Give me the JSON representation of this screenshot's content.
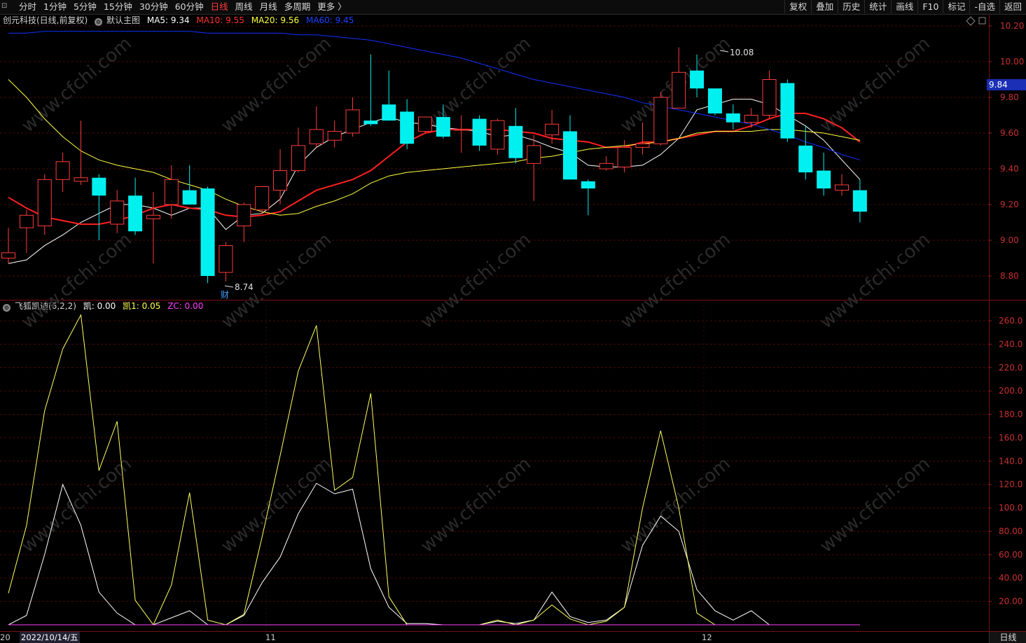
{
  "toolbar": {
    "periods": [
      "分时",
      "1分钟",
      "5分钟",
      "15分钟",
      "30分钟",
      "60分钟",
      "日线",
      "周线",
      "月线",
      "多周期",
      "更多 〉"
    ],
    "active_period": "日线",
    "right_buttons": [
      "复权",
      "叠加",
      "历史",
      "统计",
      "画线",
      "F10",
      "标记",
      "-自选",
      "返回"
    ]
  },
  "main_legend": {
    "stock": "创元科技(日线,前复权)",
    "template": "默认主图",
    "ma5": "MA5: 9.34",
    "ma10": "MA10: 9.55",
    "ma20": "MA20: 9.56",
    "ma60": "MA60: 9.45"
  },
  "sub_legend": {
    "name": "飞狐凯迪(6,2,2)",
    "kai": "凯: 0.00",
    "kai1": "凯1: 0.05",
    "zc": "ZC: 0.00"
  },
  "annotations": {
    "high": "10.08",
    "low": "8.74",
    "finance_marker": "财"
  },
  "current_price": "9.84",
  "period_label": "日线",
  "dates": {
    "first_partial": "20",
    "first_date": "2022/10/14/五",
    "month_11": "11",
    "month_12": "12"
  },
  "watermark": "www.cfchi.com",
  "colors": {
    "up": "#ff3b3b",
    "down": "#00f0f0",
    "ma5": "#ffffff",
    "ma10": "#ff2020",
    "ma20": "#ffff40",
    "ma60": "#1030ff",
    "kai": "#ffffff",
    "kai1": "#ffff60",
    "zc": "#ff40ff"
  },
  "chart_data": [
    {
      "type": "candlestick",
      "title": "创元科技(日线,前复权)",
      "y_ticks": [
        "10.20",
        "10.00",
        "9.80",
        "9.60",
        "9.40",
        "9.20",
        "9.00",
        "8.80"
      ],
      "ylim": [
        8.72,
        10.25
      ],
      "candles": [
        {
          "o": 8.9,
          "h": 9.07,
          "l": 8.87,
          "c": 8.93
        },
        {
          "o": 9.07,
          "h": 9.17,
          "l": 8.93,
          "c": 9.14
        },
        {
          "o": 9.08,
          "h": 9.37,
          "l": 9.03,
          "c": 9.34
        },
        {
          "o": 9.34,
          "h": 9.49,
          "l": 9.27,
          "c": 9.44
        },
        {
          "o": 9.33,
          "h": 9.67,
          "l": 9.31,
          "c": 9.35
        },
        {
          "o": 9.35,
          "h": 9.37,
          "l": 9.0,
          "c": 9.25
        },
        {
          "o": 9.09,
          "h": 9.28,
          "l": 9.04,
          "c": 9.22
        },
        {
          "o": 9.25,
          "h": 9.35,
          "l": 9.03,
          "c": 9.05
        },
        {
          "o": 9.12,
          "h": 9.27,
          "l": 8.87,
          "c": 9.14
        },
        {
          "o": 9.2,
          "h": 9.42,
          "l": 9.12,
          "c": 9.34
        },
        {
          "o": 9.28,
          "h": 9.42,
          "l": 9.2,
          "c": 9.2
        },
        {
          "o": 9.29,
          "h": 9.3,
          "l": 8.76,
          "c": 8.8
        },
        {
          "o": 8.82,
          "h": 8.99,
          "l": 8.77,
          "c": 8.97
        },
        {
          "o": 9.08,
          "h": 9.21,
          "l": 8.99,
          "c": 9.2
        },
        {
          "o": 9.17,
          "h": 9.3,
          "l": 9.15,
          "c": 9.3
        },
        {
          "o": 9.28,
          "h": 9.51,
          "l": 9.2,
          "c": 9.39
        },
        {
          "o": 9.39,
          "h": 9.63,
          "l": 9.38,
          "c": 9.53
        },
        {
          "o": 9.54,
          "h": 9.75,
          "l": 9.52,
          "c": 9.62
        },
        {
          "o": 9.56,
          "h": 9.67,
          "l": 9.52,
          "c": 9.61
        },
        {
          "o": 9.6,
          "h": 9.8,
          "l": 9.58,
          "c": 9.73
        },
        {
          "o": 9.67,
          "h": 10.04,
          "l": 9.64,
          "c": 9.65
        },
        {
          "o": 9.76,
          "h": 9.95,
          "l": 9.68,
          "c": 9.67
        },
        {
          "o": 9.72,
          "h": 9.79,
          "l": 9.51,
          "c": 9.54
        },
        {
          "o": 9.61,
          "h": 9.69,
          "l": 9.6,
          "c": 9.69
        },
        {
          "o": 9.69,
          "h": 9.76,
          "l": 9.57,
          "c": 9.58
        },
        {
          "o": 9.62,
          "h": 9.7,
          "l": 9.49,
          "c": 9.62
        },
        {
          "o": 9.68,
          "h": 9.7,
          "l": 9.5,
          "c": 9.53
        },
        {
          "o": 9.51,
          "h": 9.68,
          "l": 9.48,
          "c": 9.67
        },
        {
          "o": 9.64,
          "h": 9.74,
          "l": 9.43,
          "c": 9.46
        },
        {
          "o": 9.43,
          "h": 9.59,
          "l": 9.22,
          "c": 9.53
        },
        {
          "o": 9.59,
          "h": 9.73,
          "l": 9.54,
          "c": 9.65
        },
        {
          "o": 9.61,
          "h": 9.7,
          "l": 9.36,
          "c": 9.34
        },
        {
          "o": 9.33,
          "h": 9.34,
          "l": 9.14,
          "c": 9.29
        },
        {
          "o": 9.4,
          "h": 9.47,
          "l": 9.39,
          "c": 9.43
        },
        {
          "o": 9.41,
          "h": 9.56,
          "l": 9.38,
          "c": 9.52
        },
        {
          "o": 9.52,
          "h": 9.66,
          "l": 9.48,
          "c": 9.54
        },
        {
          "o": 9.54,
          "h": 9.83,
          "l": 9.53,
          "c": 9.8
        },
        {
          "o": 9.74,
          "h": 10.08,
          "l": 9.74,
          "c": 9.94
        },
        {
          "o": 9.95,
          "h": 10.04,
          "l": 9.8,
          "c": 9.85
        },
        {
          "o": 9.85,
          "h": 9.85,
          "l": 9.7,
          "c": 9.71
        },
        {
          "o": 9.71,
          "h": 9.76,
          "l": 9.62,
          "c": 9.66
        },
        {
          "o": 9.66,
          "h": 9.74,
          "l": 9.63,
          "c": 9.7
        },
        {
          "o": 9.7,
          "h": 9.95,
          "l": 9.68,
          "c": 9.9
        },
        {
          "o": 9.88,
          "h": 9.9,
          "l": 9.55,
          "c": 9.57
        },
        {
          "o": 9.53,
          "h": 9.64,
          "l": 9.34,
          "c": 9.38
        },
        {
          "o": 9.39,
          "h": 9.49,
          "l": 9.25,
          "c": 9.29
        },
        {
          "o": 9.28,
          "h": 9.37,
          "l": 9.25,
          "c": 9.31
        },
        {
          "o": 9.28,
          "h": 9.34,
          "l": 9.1,
          "c": 9.16
        }
      ],
      "series": [
        {
          "name": "MA5",
          "values": [
            8.87,
            8.89,
            8.97,
            9.03,
            9.1,
            9.15,
            9.2,
            9.2,
            9.18,
            9.14,
            9.18,
            9.18,
            9.06,
            9.14,
            9.15,
            9.23,
            9.42,
            9.52,
            9.58,
            9.62,
            9.66,
            9.69,
            9.66,
            9.65,
            9.63,
            9.62,
            9.61,
            9.58,
            9.59,
            9.56,
            9.52,
            9.49,
            9.42,
            9.41,
            9.41,
            9.42,
            9.48,
            9.57,
            9.73,
            9.76,
            9.79,
            9.79,
            9.76,
            9.7,
            9.64,
            9.56,
            9.45,
            9.34
          ]
        },
        {
          "name": "MA10",
          "values": [
            9.24,
            9.18,
            9.13,
            9.11,
            9.09,
            9.09,
            9.11,
            9.14,
            9.18,
            9.2,
            9.18,
            9.17,
            9.14,
            9.13,
            9.14,
            9.16,
            9.22,
            9.28,
            9.31,
            9.34,
            9.39,
            9.47,
            9.55,
            9.6,
            9.62,
            9.62,
            9.62,
            9.62,
            9.61,
            9.6,
            9.57,
            9.56,
            9.55,
            9.52,
            9.52,
            9.55,
            9.55,
            9.57,
            9.59,
            9.61,
            9.61,
            9.64,
            9.68,
            9.71,
            9.71,
            9.68,
            9.63,
            9.55
          ]
        },
        {
          "name": "MA20",
          "values": [
            9.9,
            9.8,
            9.68,
            9.58,
            9.5,
            9.45,
            9.42,
            9.4,
            9.38,
            9.34,
            9.31,
            9.28,
            9.23,
            9.19,
            9.16,
            9.14,
            9.15,
            9.19,
            9.22,
            9.26,
            9.32,
            9.36,
            9.38,
            9.39,
            9.4,
            9.41,
            9.42,
            9.43,
            9.44,
            9.46,
            9.47,
            9.49,
            9.51,
            9.52,
            9.53,
            9.54,
            9.55,
            9.57,
            9.6,
            9.61,
            9.61,
            9.61,
            9.62,
            9.62,
            9.61,
            9.6,
            9.58,
            9.56
          ]
        },
        {
          "name": "MA60",
          "values": [
            10.16,
            10.16,
            10.17,
            10.17,
            10.17,
            10.17,
            10.17,
            10.17,
            10.17,
            10.17,
            10.17,
            10.16,
            10.16,
            10.16,
            10.16,
            10.16,
            10.15,
            10.15,
            10.14,
            10.13,
            10.12,
            10.1,
            10.08,
            10.06,
            10.04,
            10.02,
            9.99,
            9.96,
            9.93,
            9.9,
            9.88,
            9.86,
            9.84,
            9.82,
            9.8,
            9.77,
            9.75,
            9.73,
            9.71,
            9.69,
            9.67,
            9.65,
            9.62,
            9.59,
            9.55,
            9.52,
            9.48,
            9.45
          ]
        }
      ]
    },
    {
      "type": "line",
      "title": "飞狐凯迪(6,2,2)",
      "y_ticks": [
        "260.0",
        "240.0",
        "220.0",
        "200.0",
        "180.0",
        "160.0",
        "140.0",
        "120.0",
        "100.0",
        "80.00",
        "60.00",
        "40.00",
        "20.00"
      ],
      "ylim": [
        -12,
        270
      ],
      "series": [
        {
          "name": "凯",
          "values": [
            0,
            8,
            60,
            120,
            85,
            28,
            10,
            0,
            0,
            6,
            12,
            0,
            0,
            8,
            36,
            58,
            95,
            121,
            112,
            116,
            48,
            15,
            1,
            1,
            0,
            0,
            0,
            3,
            1,
            4,
            28,
            7,
            2,
            4,
            15,
            68,
            93,
            80,
            30,
            12,
            4,
            12,
            0,
            0,
            0,
            0,
            0,
            0
          ]
        },
        {
          "name": "凯1",
          "values": [
            27,
            85,
            183,
            236,
            265,
            132,
            174,
            21,
            0,
            34,
            113,
            4,
            0,
            9,
            75,
            145,
            217,
            256,
            115,
            126,
            198,
            24,
            0,
            0,
            0,
            0,
            0,
            4,
            0,
            4,
            17,
            5,
            0,
            3,
            15,
            100,
            166,
            100,
            10,
            0,
            0,
            0,
            0,
            0,
            0,
            0,
            0,
            0
          ]
        },
        {
          "name": "ZC",
          "values": [
            0,
            0,
            0,
            0,
            0,
            0,
            0,
            0,
            0,
            0,
            0,
            0,
            0,
            0,
            0,
            0,
            0,
            0,
            0,
            0,
            0,
            0,
            0,
            0,
            0,
            0,
            0,
            0,
            0,
            0,
            0,
            0,
            0,
            0,
            0,
            0,
            0,
            0,
            0,
            0,
            0,
            0,
            0,
            0,
            0,
            0,
            0,
            0
          ]
        }
      ]
    }
  ]
}
